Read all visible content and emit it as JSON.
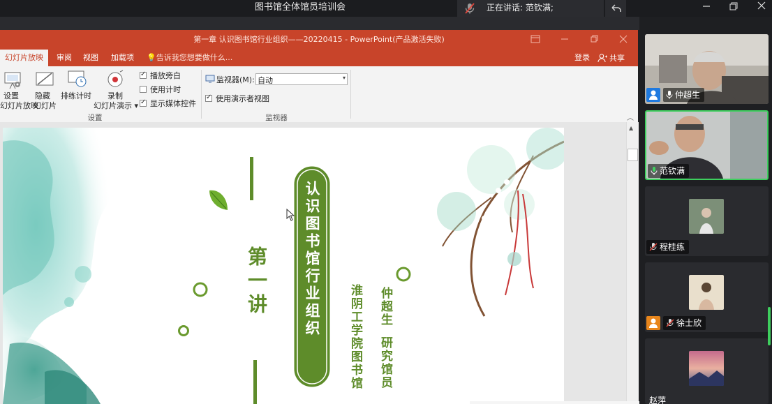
{
  "meeting": {
    "title": "图书馆全体馆员培训会",
    "speaking": "正在讲话: 范钦满;"
  },
  "ppt": {
    "window_title": "第一章 认识图书馆行业组织——20220415 - PowerPoint(产品激活失败)",
    "tabs": [
      "幻灯片放映",
      "审阅",
      "视图",
      "加载项"
    ],
    "tell_me": "告诉我您想要做什么...",
    "login": "登录",
    "share": "共享",
    "ribbon": {
      "setup_show_1": "设置",
      "setup_show_2": "幻灯片放映",
      "hide_slide_1": "隐藏",
      "hide_slide_2": "幻灯片",
      "rehearse": "排练计时",
      "record_1": "录制",
      "record_2": "幻灯片演示",
      "chk_narration": "播放旁白",
      "chk_timings": "使用计时",
      "chk_media": "显示媒体控件",
      "group_setup": "设置",
      "monitor_label": "监视器(M):",
      "monitor_value": "自动",
      "presenter_view": "使用演示者视图",
      "group_monitor": "监视器"
    },
    "checks": {
      "narration": true,
      "timings": false,
      "media": true,
      "presenter": true
    },
    "slide": {
      "lecture": "第一讲",
      "title": "认识图书馆行业组织",
      "institution": "淮阴工学院图书馆",
      "speaker": "仲超生 研究馆员"
    }
  },
  "participants": [
    {
      "name": "仲超生",
      "type": "video"
    },
    {
      "name": "范钦满",
      "type": "video",
      "active": true
    },
    {
      "name": "程桂练",
      "type": "avatar"
    },
    {
      "name": "徐士欣",
      "type": "avatar"
    },
    {
      "name": "赵萍",
      "type": "avatar"
    }
  ],
  "colors": {
    "ppt_red": "#c8442a",
    "slide_green": "#5e8c2a",
    "active_border": "#3ecf5e"
  }
}
